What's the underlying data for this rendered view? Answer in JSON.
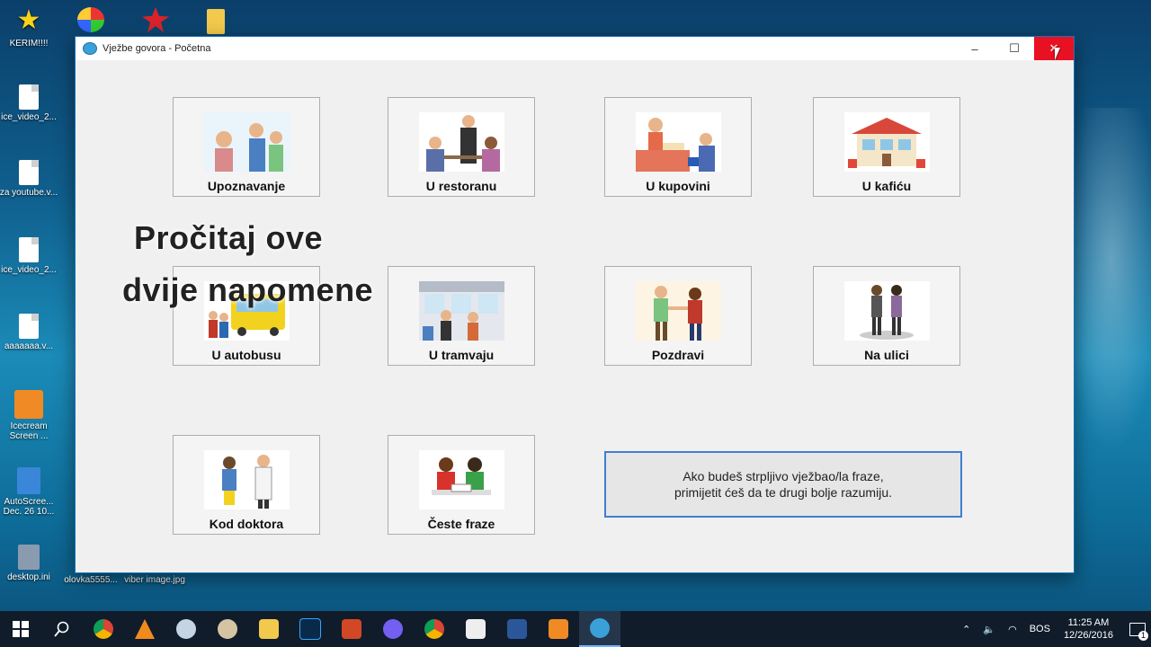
{
  "desktop": {
    "icons": [
      {
        "label": "KERIM!!!!"
      },
      {
        "label": "ice_video_2..."
      },
      {
        "label": "za youtube.v..."
      },
      {
        "label": "ice_video_2..."
      },
      {
        "label": "aaaaaaa.v..."
      },
      {
        "label": "Icecream Screen ..."
      },
      {
        "label": "AutoScree... Dec. 26 10..."
      },
      {
        "label": "desktop.ini"
      },
      {
        "label": "olovka5555..."
      },
      {
        "label": "viber image.jpg"
      }
    ]
  },
  "window": {
    "title": "Vježbe govora - Početna",
    "minimize": "–",
    "maximize": "☐",
    "close": "✕"
  },
  "tiles": [
    {
      "label": "Upoznavanje",
      "icon": "meeting-people-icon"
    },
    {
      "label": "U restoranu",
      "icon": "restaurant-icon"
    },
    {
      "label": "U kupovini",
      "icon": "shopping-icon"
    },
    {
      "label": "U kafiću",
      "icon": "cafe-icon"
    },
    {
      "label": "U autobusu",
      "icon": "bus-icon"
    },
    {
      "label": "U tramvaju",
      "icon": "tram-icon"
    },
    {
      "label": "Pozdravi",
      "icon": "greeting-icon"
    },
    {
      "label": "Na ulici",
      "icon": "street-icon"
    },
    {
      "label": "Kod doktora",
      "icon": "doctor-icon"
    },
    {
      "label": "Česte fraze",
      "icon": "phrases-icon"
    }
  ],
  "note": {
    "line1": "Ako budeš strpljivo vježbao/la fraze,",
    "line2": "primijetit ćeš da te drugi bolje razumiju."
  },
  "overlay": {
    "line1": "Pročitaj ove",
    "line2": "dvije napomene"
  },
  "taskbar": {
    "language": "BOS",
    "time": "11:25 AM",
    "date": "12/26/2016",
    "notifications": "1"
  }
}
